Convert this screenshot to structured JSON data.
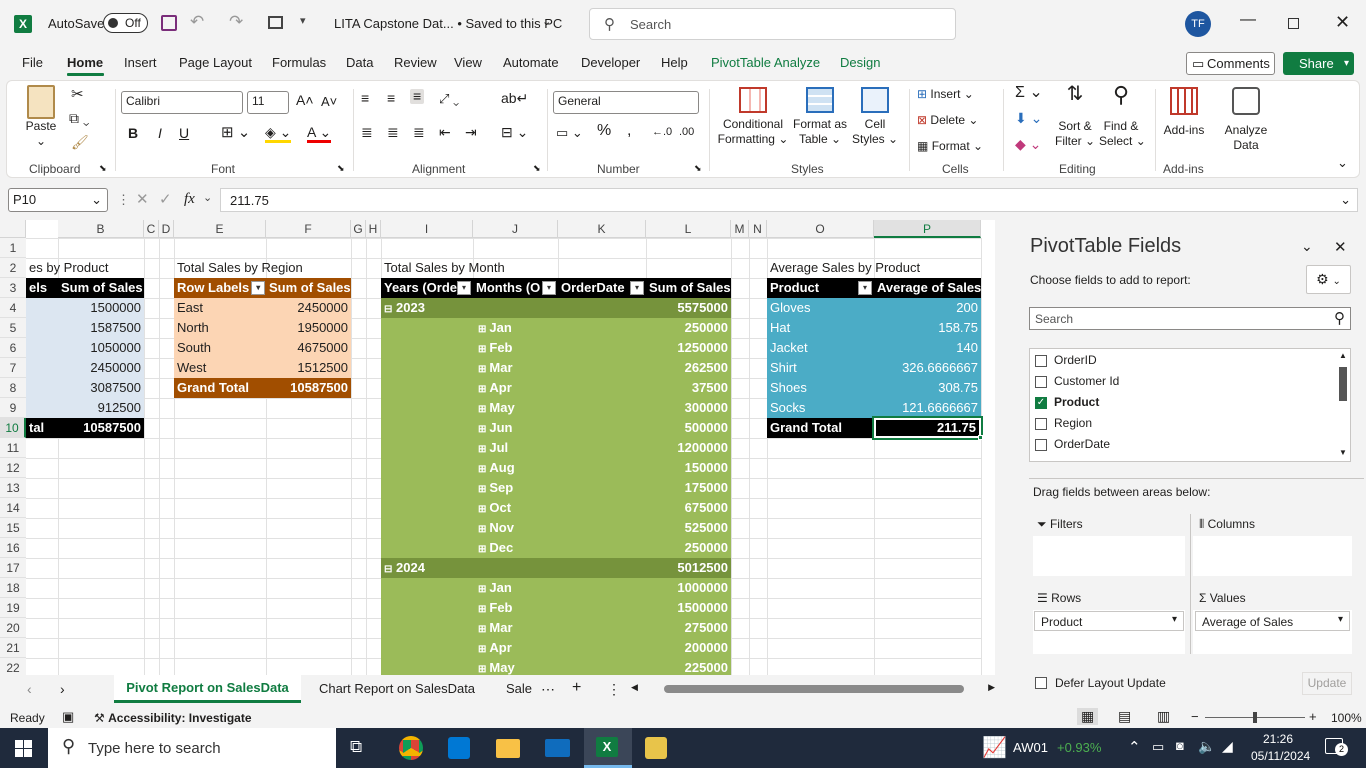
{
  "titlebar": {
    "autosave_label": "AutoSave",
    "autosave_state": "Off",
    "doc_title": "LITA Capstone Dat... • Saved to this PC",
    "search_placeholder": "Search",
    "user_initials": "TF"
  },
  "tabs": [
    "File",
    "Home",
    "Insert",
    "Page Layout",
    "Formulas",
    "Data",
    "Review",
    "View",
    "Automate",
    "Developer",
    "Help",
    "PivotTable Analyze",
    "Design"
  ],
  "actions": {
    "comments": "Comments",
    "share": "Share"
  },
  "ribbon": {
    "groups": [
      "Clipboard",
      "Font",
      "Alignment",
      "Number",
      "Styles",
      "Cells",
      "Editing",
      "Add-ins"
    ],
    "paste": "Paste",
    "font_name": "Calibri",
    "font_size": "11",
    "number_format": "General",
    "conditional_formatting": [
      "Conditional",
      "Formatting"
    ],
    "format_as_table": [
      "Format as",
      "Table"
    ],
    "cell_styles": [
      "Cell",
      "Styles"
    ],
    "insert": "Insert",
    "delete": "Delete",
    "format": "Format",
    "sort_filter": [
      "Sort &",
      "Filter"
    ],
    "find_select": [
      "Find &",
      "Select"
    ],
    "addins": "Add-ins",
    "analyze": [
      "Analyze",
      "Data"
    ],
    "bold": "B",
    "italic": "I",
    "underline": "U"
  },
  "formula_bar": {
    "name_box": "P10",
    "fx": "fx",
    "value": "211.75"
  },
  "columns": [
    "B",
    "C",
    "D",
    "E",
    "F",
    "G",
    "H",
    "I",
    "J",
    "K",
    "L",
    "M",
    "N",
    "O",
    "P"
  ],
  "rows": [
    "1",
    "2",
    "3",
    "4",
    "5",
    "6",
    "7",
    "8",
    "9",
    "10",
    "11",
    "12",
    "13",
    "14",
    "15",
    "16",
    "17",
    "18",
    "19",
    "20",
    "21",
    "22"
  ],
  "pivot_product": {
    "title": "es by Product",
    "header_a": "els",
    "header_b": "Sum of Sales",
    "values": [
      "1500000",
      "1587500",
      "1050000",
      "2450000",
      "3087500",
      "912500"
    ],
    "total_label": "tal",
    "total": "10587500"
  },
  "pivot_region": {
    "title": "Total Sales by Region",
    "header_a": "Row Labels",
    "header_b": "Sum of Sales",
    "rows": [
      {
        "label": "East",
        "value": "2450000"
      },
      {
        "label": "North",
        "value": "1950000"
      },
      {
        "label": "South",
        "value": "4675000"
      },
      {
        "label": "West",
        "value": "1512500"
      }
    ],
    "total_label": "Grand Total",
    "total": "10587500"
  },
  "pivot_month": {
    "title": "Total Sales by Month",
    "headers": [
      "Years (Orde",
      "Months (O",
      "OrderDate",
      "Sum of Sales"
    ],
    "year1": {
      "label": "2023",
      "value": "5575000"
    },
    "months1": [
      {
        "m": "Jan",
        "v": "250000"
      },
      {
        "m": "Feb",
        "v": "1250000"
      },
      {
        "m": "Mar",
        "v": "262500"
      },
      {
        "m": "Apr",
        "v": "37500"
      },
      {
        "m": "May",
        "v": "300000"
      },
      {
        "m": "Jun",
        "v": "500000"
      },
      {
        "m": "Jul",
        "v": "1200000"
      },
      {
        "m": "Aug",
        "v": "150000"
      },
      {
        "m": "Sep",
        "v": "175000"
      },
      {
        "m": "Oct",
        "v": "675000"
      },
      {
        "m": "Nov",
        "v": "525000"
      },
      {
        "m": "Dec",
        "v": "250000"
      }
    ],
    "year2": {
      "label": "2024",
      "value": "5012500"
    },
    "months2": [
      {
        "m": "Jan",
        "v": "1000000"
      },
      {
        "m": "Feb",
        "v": "1500000"
      },
      {
        "m": "Mar",
        "v": "275000"
      },
      {
        "m": "Apr",
        "v": "200000"
      },
      {
        "m": "May",
        "v": "225000"
      }
    ]
  },
  "pivot_avg": {
    "title": "Average Sales by Product",
    "header_a": "Product",
    "header_b": "Average of Sales",
    "rows": [
      {
        "label": "Gloves",
        "value": "200"
      },
      {
        "label": "Hat",
        "value": "158.75"
      },
      {
        "label": "Jacket",
        "value": "140"
      },
      {
        "label": "Shirt",
        "value": "326.6666667"
      },
      {
        "label": "Shoes",
        "value": "308.75"
      },
      {
        "label": "Socks",
        "value": "121.6666667"
      }
    ],
    "total_label": "Grand Total",
    "total": "211.75"
  },
  "pane": {
    "title": "PivotTable Fields",
    "subtitle": "Choose fields to add to report:",
    "search_placeholder": "Search",
    "fields": [
      {
        "name": "OrderID",
        "checked": false
      },
      {
        "name": "Customer Id",
        "checked": false
      },
      {
        "name": "Product",
        "checked": true
      },
      {
        "name": "Region",
        "checked": false
      },
      {
        "name": "OrderDate",
        "checked": false
      }
    ],
    "drag_label": "Drag fields between areas below:",
    "filters": "Filters",
    "columns": "Columns",
    "rows": "Rows",
    "values": "Values",
    "rows_field": "Product",
    "values_field": "Average of Sales",
    "defer": "Defer Layout Update",
    "update": "Update"
  },
  "sheets": [
    "Pivot Report on SalesData",
    "Chart Report on SalesData",
    "Sale"
  ],
  "status": {
    "ready": "Ready",
    "accessibility": "Accessibility: Investigate",
    "zoom": "100%"
  },
  "taskbar": {
    "search_placeholder": "Type here to search",
    "stock_name": "AW01",
    "stock_change": "+0.93%",
    "time": "21:26",
    "date": "05/11/2024",
    "notifications": "2"
  }
}
